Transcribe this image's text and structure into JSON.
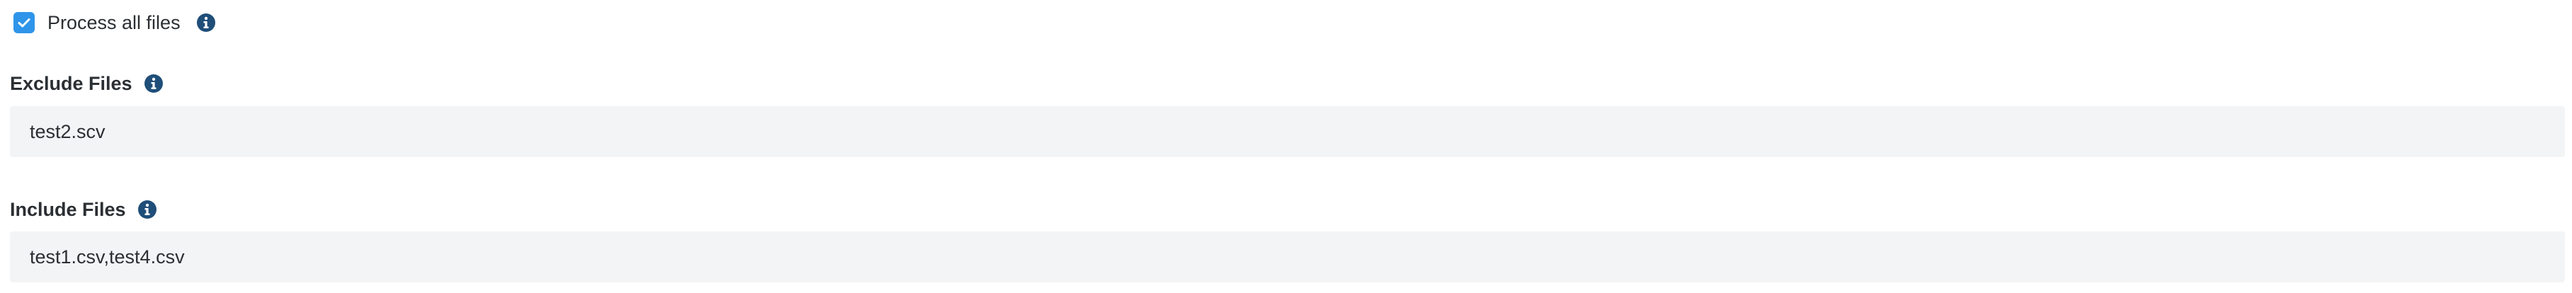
{
  "process_all": {
    "label": "Process all files",
    "checked": "true"
  },
  "exclude": {
    "label": "Exclude Files",
    "value": "test2.scv"
  },
  "include": {
    "label": "Include Files",
    "value": "test1.csv,test4.csv"
  },
  "colors": {
    "accent": "#2f95ea",
    "info_icon": "#1f4e79",
    "input_bg": "#f3f4f6",
    "text": "#2b2f33"
  },
  "icons": {
    "checkbox": "check-icon",
    "info": "info-icon"
  }
}
